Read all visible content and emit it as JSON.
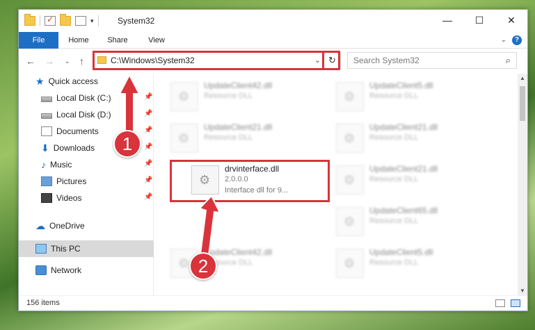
{
  "window": {
    "title": "System32",
    "controls": {
      "minimize": "—",
      "maximize": "☐",
      "close": "✕"
    }
  },
  "ribbon": {
    "tabs": [
      "File",
      "Home",
      "Share",
      "View"
    ],
    "help": "?"
  },
  "address_bar": {
    "path": "C:\\Windows\\System32",
    "refresh_icon": "↻",
    "dropdown_icon": "⌄"
  },
  "search": {
    "placeholder": "Search System32",
    "icon": "⌕"
  },
  "nav_buttons": {
    "back": "←",
    "forward": "→",
    "recent": "⌄",
    "up": "↑"
  },
  "nav_pane": {
    "items": [
      {
        "label": "Quick access",
        "icon": "quick-access-star-icon",
        "pinned": false
      },
      {
        "label": "Local Disk (C:)",
        "icon": "drive-icon",
        "pinned": true
      },
      {
        "label": "Local Disk (D:)",
        "icon": "drive-icon",
        "pinned": true
      },
      {
        "label": "Documents",
        "icon": "documents-icon",
        "pinned": true
      },
      {
        "label": "Downloads",
        "icon": "downloads-icon",
        "pinned": true
      },
      {
        "label": "Music",
        "icon": "music-icon",
        "pinned": true
      },
      {
        "label": "Pictures",
        "icon": "pictures-icon",
        "pinned": true
      },
      {
        "label": "Videos",
        "icon": "videos-icon",
        "pinned": true
      },
      {
        "label": "OneDrive",
        "icon": "onedrive-icon",
        "pinned": false
      },
      {
        "label": "This PC",
        "icon": "this-pc-icon",
        "pinned": false,
        "selected": true
      },
      {
        "label": "Network",
        "icon": "network-icon",
        "pinned": false
      }
    ]
  },
  "files": [
    {
      "name": "UpdateClient42.dll",
      "desc": "Resource DLL",
      "blurred": true
    },
    {
      "name": "UpdateClient5.dll",
      "desc": "Resource DLL",
      "blurred": true
    },
    {
      "name": "UpdateClient21.dll",
      "desc": "Resource DLL",
      "blurred": true
    },
    {
      "name": "UpdateClient21.dll",
      "desc": "Resource DLL",
      "blurred": true
    },
    {
      "name": "drvinterface.dll",
      "version": "2.0.0.0",
      "desc": "Interface dll for 9...",
      "blurred": false
    },
    {
      "name": "UpdateClient21.dll",
      "desc": "Resource DLL",
      "blurred": true
    },
    {
      "name": "UpdateClient65.dll",
      "desc": "Resource DLL",
      "blurred": true
    },
    {
      "name": "UpdateClient42.dll",
      "desc": "Resource DLL",
      "blurred": true
    },
    {
      "name": "UpdateClient5.dll",
      "desc": "Resource DLL",
      "blurred": true
    }
  ],
  "status_bar": {
    "item_count": "156 items"
  },
  "callouts": {
    "step1": "1",
    "step2": "2"
  },
  "colors": {
    "accent": "#1e6fc4",
    "highlight": "#d9333b"
  }
}
